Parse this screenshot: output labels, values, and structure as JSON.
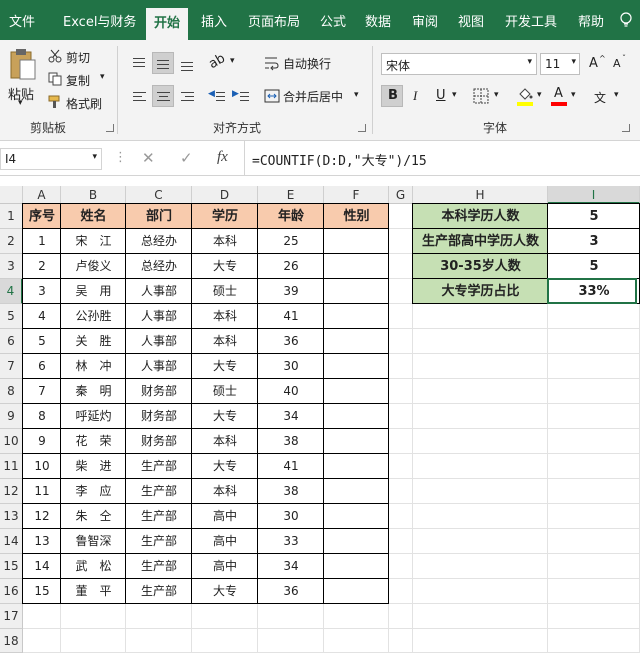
{
  "menu": {
    "tabs": [
      "文件",
      "Excel与财务",
      "开始",
      "插入",
      "页面布局",
      "公式",
      "数据",
      "审阅",
      "视图",
      "开发工具",
      "帮助"
    ],
    "active": "开始"
  },
  "ribbon": {
    "paste": "粘贴",
    "cut": "剪切",
    "copy": "复制",
    "format_painter": "格式刷",
    "clipboard_group": "剪贴板",
    "wrap_text": "自动换行",
    "merge_center": "合并后居中",
    "alignment_group": "对齐方式",
    "font_name": "宋体",
    "font_size": "11",
    "font_group": "字体",
    "bold": "B",
    "italic": "I",
    "underline": "U",
    "grow_font": "A",
    "shrink_font": "A",
    "font_color": "A",
    "wen": "文",
    "accent_color": "#217346",
    "font_color_bar": "#ff0000",
    "fill_color_bar": "#ffff00"
  },
  "formula_bar": {
    "name_box": "I4",
    "fx": "fx",
    "formula": "=COUNTIF(D:D,\"大专\")/15"
  },
  "sheet": {
    "columns": [
      "A",
      "B",
      "C",
      "D",
      "E",
      "F",
      "G",
      "H",
      "I"
    ],
    "rows": [
      "1",
      "2",
      "3",
      "4",
      "5",
      "6",
      "7",
      "8",
      "9",
      "10",
      "11",
      "12",
      "13",
      "14",
      "15",
      "16",
      "17",
      "18"
    ],
    "selected_col": "I",
    "selected_row": "4",
    "headers": [
      "序号",
      "姓名",
      "部门",
      "学历",
      "年龄",
      "性别"
    ],
    "data": [
      [
        "1",
        "宋　江",
        "总经办",
        "本科",
        "25",
        ""
      ],
      [
        "2",
        "卢俊义",
        "总经办",
        "大专",
        "26",
        ""
      ],
      [
        "3",
        "吴　用",
        "人事部",
        "硕士",
        "39",
        ""
      ],
      [
        "4",
        "公孙胜",
        "人事部",
        "本科",
        "41",
        ""
      ],
      [
        "5",
        "关　胜",
        "人事部",
        "本科",
        "36",
        ""
      ],
      [
        "6",
        "林　冲",
        "人事部",
        "大专",
        "30",
        ""
      ],
      [
        "7",
        "秦　明",
        "财务部",
        "硕士",
        "40",
        ""
      ],
      [
        "8",
        "呼延灼",
        "财务部",
        "大专",
        "34",
        ""
      ],
      [
        "9",
        "花　荣",
        "财务部",
        "本科",
        "38",
        ""
      ],
      [
        "10",
        "柴　进",
        "生产部",
        "大专",
        "41",
        ""
      ],
      [
        "11",
        "李　应",
        "生产部",
        "本科",
        "38",
        ""
      ],
      [
        "12",
        "朱　仝",
        "生产部",
        "高中",
        "30",
        ""
      ],
      [
        "13",
        "鲁智深",
        "生产部",
        "高中",
        "33",
        ""
      ],
      [
        "14",
        "武　松",
        "生产部",
        "高中",
        "34",
        ""
      ],
      [
        "15",
        "董　平",
        "生产部",
        "大专",
        "36",
        ""
      ]
    ],
    "summary": [
      {
        "label": "本科学历人数",
        "value": "5"
      },
      {
        "label": "生产部高中学历人数",
        "value": "3"
      },
      {
        "label": "30-35岁人数",
        "value": "5"
      },
      {
        "label": "大专学历占比",
        "value": "33%"
      }
    ],
    "header_fill": "#f8cbad",
    "summary_fill": "#c6e0b4"
  }
}
